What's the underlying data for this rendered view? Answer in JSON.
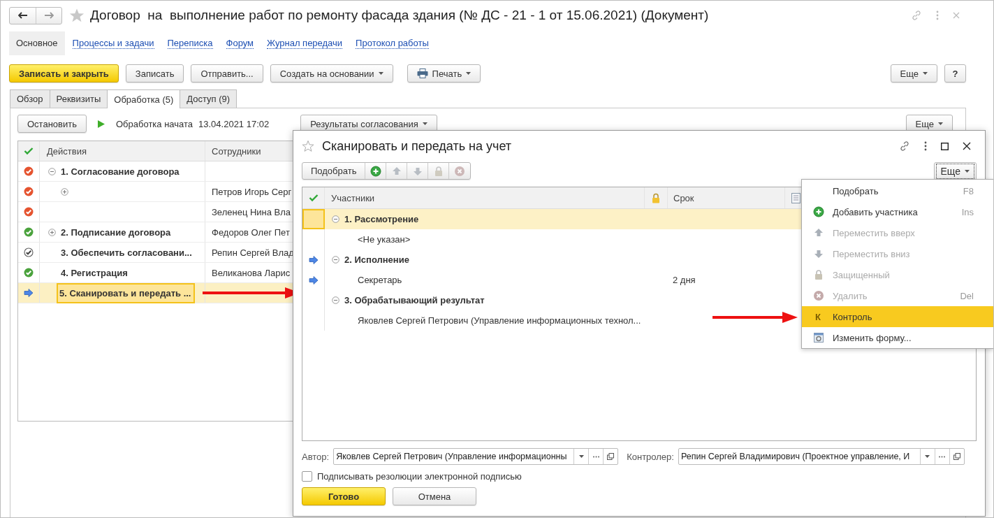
{
  "window": {
    "title": "Договор  на  выполнение работ по ремонту фасада здания (№ ДС - 21 - 1 от 15.06.2021) (Документ)"
  },
  "nav": [
    {
      "label": "Основное",
      "selected": true
    },
    {
      "label": "Процессы и задачи",
      "selected": false
    },
    {
      "label": "Переписка",
      "selected": false
    },
    {
      "label": "Форум",
      "selected": false
    },
    {
      "label": "Журнал передачи",
      "selected": false
    },
    {
      "label": "Протокол работы",
      "selected": false
    }
  ],
  "toolbar": {
    "buttons": [
      {
        "label": "Записать и закрыть",
        "kind": "primary"
      },
      {
        "label": "Записать",
        "kind": "plain"
      },
      {
        "label": "Отправить...",
        "kind": "plain"
      },
      {
        "label": "Создать на основании",
        "kind": "dropdown"
      },
      {
        "label": "Печать",
        "kind": "print"
      }
    ],
    "more": "Еще",
    "help": "?"
  },
  "tabs": [
    {
      "label": "Обзор",
      "selected": false
    },
    {
      "label": "Реквизиты",
      "selected": false
    },
    {
      "label": "Обработка (5)",
      "selected": true
    },
    {
      "label": "Доступ (9)",
      "selected": false
    }
  ],
  "processing": {
    "stop": "Остановить",
    "status": "Обработка начата",
    "started": "13.04.2021 17:02",
    "results": "Результаты согласования",
    "more": "Еще",
    "columns": [
      "Действия",
      "Сотрудники"
    ],
    "rows": [
      {
        "kind": "declined",
        "action": "1. Согласование договора",
        "expanded": true,
        "selected": false,
        "children": [
          {
            "kind": "declined",
            "expanded": false,
            "employee": "Петров Игорь Серг",
            "selected": false
          },
          {
            "kind": "declined",
            "employee": "Зеленец Нина Вла",
            "selected": false
          }
        ]
      },
      {
        "kind": "done",
        "action": "2. Подписание договора",
        "expanded": false,
        "employee": "Федоров Олег Пет",
        "selected": false
      },
      {
        "kind": "pending",
        "action": "3. Обеспечить согласовани...",
        "employee": "Репин Сергей Влад",
        "selected": false
      },
      {
        "kind": "done",
        "action": "4. Регистрация",
        "employee": "Великанова Ларис",
        "selected": false
      },
      {
        "kind": "current",
        "action": "5. Сканировать и передать ...",
        "selected": true
      }
    ]
  },
  "dialog": {
    "title": "Сканировать и передать на учет",
    "toolbar": {
      "pick": "Подобрать",
      "icons": [
        {
          "kind": "add",
          "disabled": false
        },
        {
          "kind": "up",
          "disabled": true
        },
        {
          "kind": "down",
          "disabled": true
        },
        {
          "kind": "lock",
          "disabled": true
        },
        {
          "kind": "delete",
          "disabled": true
        }
      ],
      "more": "Еще"
    },
    "columns": [
      "Участники",
      "Срок"
    ],
    "stages": [
      {
        "name": "1. Рассмотрение",
        "kind": "plain",
        "expanded": true,
        "selected": true,
        "children": [
          {
            "name": "<Не указан>",
            "kind": "plain",
            "selected": false
          }
        ]
      },
      {
        "name": "2. Исполнение",
        "kind": "current",
        "expanded": true,
        "selected": false,
        "children": [
          {
            "name": "Секретарь",
            "kind": "current",
            "term": "2 дня",
            "selected": false
          }
        ]
      },
      {
        "name": "3. Обрабатывающий результат",
        "kind": "plain",
        "expanded": true,
        "selected": false,
        "children": [
          {
            "name": "Яковлев Сергей Петрович (Управление информационных технол...",
            "kind": "plain",
            "selected": false
          }
        ]
      }
    ],
    "author": {
      "label": "Автор:",
      "value": "Яковлев Сергей Петрович (Управление информационны"
    },
    "controller": {
      "label": "Контролер:",
      "value": "Репин Сергей Владимирович (Проектное управление, И"
    },
    "sign": {
      "label": "Подписывать резолюции электронной подписью",
      "checked": false
    },
    "ok": "Готово",
    "cancel": "Отмена"
  },
  "menu": [
    {
      "label": "Подобрать",
      "shortcut": "F8",
      "kind": "plain",
      "disabled": false,
      "selected": false
    },
    {
      "label": "Добавить участника",
      "shortcut": "Ins",
      "kind": "add",
      "disabled": false,
      "selected": false
    },
    {
      "label": "Переместить вверх",
      "kind": "up",
      "disabled": true,
      "selected": false
    },
    {
      "label": "Переместить вниз",
      "kind": "down",
      "disabled": true,
      "selected": false
    },
    {
      "label": "Защищенный",
      "kind": "lock",
      "disabled": true,
      "selected": false
    },
    {
      "label": "Удалить",
      "shortcut": "Del",
      "kind": "delete",
      "disabled": true,
      "selected": false
    },
    {
      "label": "Контроль",
      "kind": "letter",
      "glyph": "К",
      "disabled": false,
      "selected": true
    },
    {
      "label": "Изменить форму...",
      "kind": "form",
      "disabled": false,
      "selected": false
    }
  ]
}
